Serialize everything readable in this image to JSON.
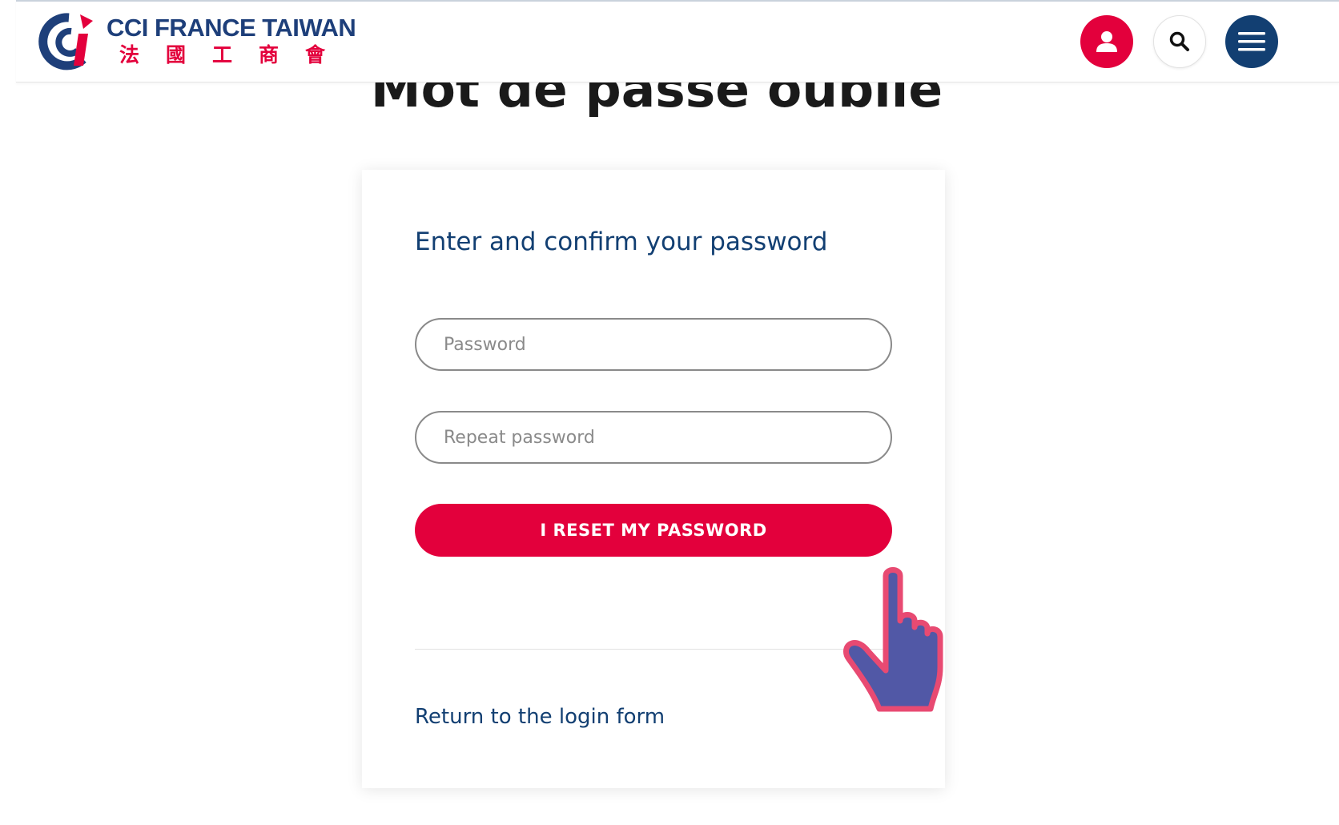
{
  "header": {
    "brand_name": "CCI FRANCE TAIWAN",
    "brand_chinese": "法國工商會",
    "icons": [
      "user-icon",
      "search-icon",
      "menu-icon"
    ],
    "colors": {
      "brand_blue": "#1e3f7a",
      "accent_red": "#e3003c",
      "navy": "#123f72"
    }
  },
  "page": {
    "title": "Mot de passe oublié"
  },
  "form": {
    "heading": "Enter and confirm your password",
    "password_placeholder": "Password",
    "repeat_placeholder": "Repeat password",
    "submit_label": "I RESET MY PASSWORD",
    "login_link": "Return to the login form"
  },
  "overlay": {
    "cursor_icon": "hand-pointer-icon"
  }
}
